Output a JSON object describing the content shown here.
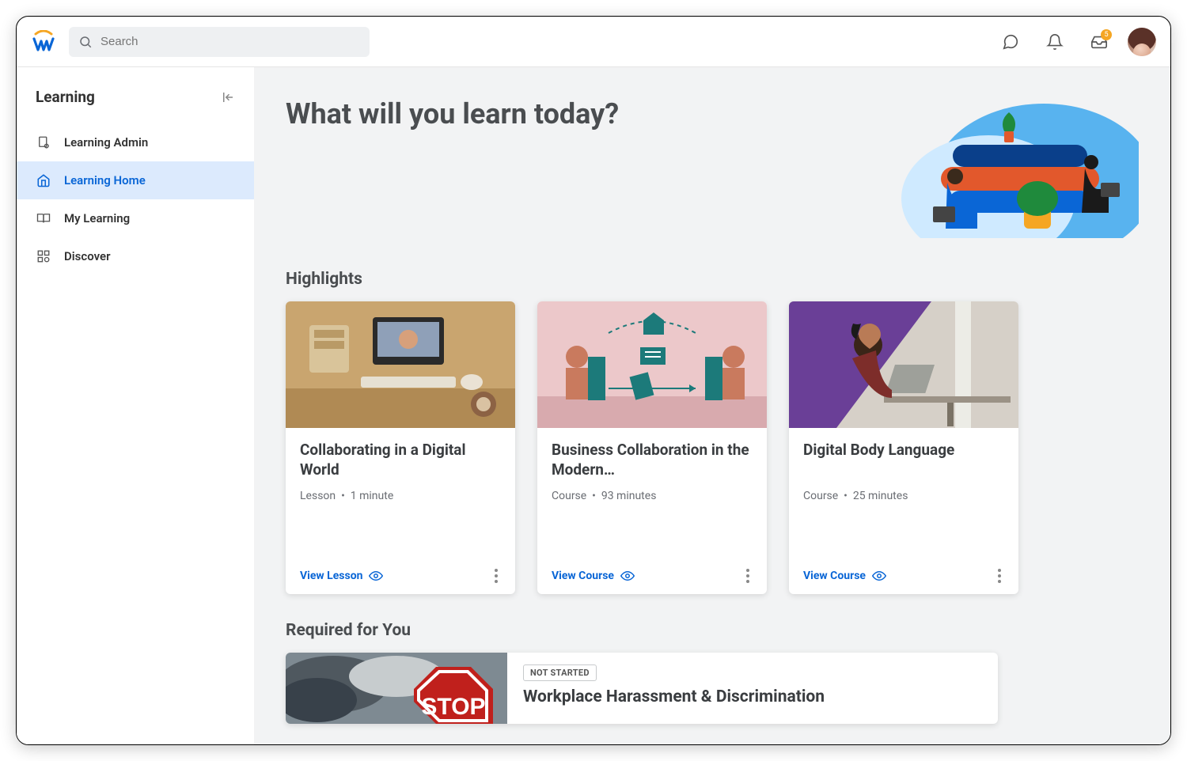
{
  "header": {
    "search_placeholder": "Search",
    "inbox_badge": "5"
  },
  "sidebar": {
    "title": "Learning",
    "items": [
      {
        "label": "Learning Admin",
        "icon": "clipboard-gear-icon",
        "active": false
      },
      {
        "label": "Learning Home",
        "icon": "home-icon",
        "active": true
      },
      {
        "label": "My Learning",
        "icon": "book-open-icon",
        "active": false
      },
      {
        "label": "Discover",
        "icon": "grid-plus-icon",
        "active": false
      }
    ]
  },
  "main": {
    "hero_title": "What will you learn today?",
    "highlights_title": "Highlights",
    "required_title": "Required for You",
    "highlights": [
      {
        "title": "Collaborating in a Digital World",
        "type": "Lesson",
        "duration": "1 minute",
        "cta": "View Lesson"
      },
      {
        "title": "Business Collaboration in the Modern…",
        "type": "Course",
        "duration": "93 minutes",
        "cta": "View Course"
      },
      {
        "title": "Digital Body Language",
        "type": "Course",
        "duration": "25 minutes",
        "cta": "View Course"
      }
    ],
    "required": {
      "status": "NOT STARTED",
      "title": "Workplace Harassment & Discrimination"
    }
  },
  "colors": {
    "accent_blue": "#0a66d6",
    "brand_orange": "#f5a623",
    "bg_main": "#f2f3f4",
    "active_bg": "#dceafd"
  }
}
